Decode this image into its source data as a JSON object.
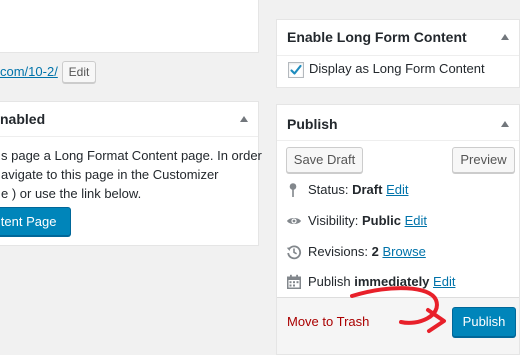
{
  "permalink": {
    "url_fragment": "com/10-2/",
    "edit_button": "Edit"
  },
  "long_format_box": {
    "title": "nabled",
    "desc_line1": "s page a Long Format Content page. In order",
    "desc_line2": "avigate to this page in the Customizer",
    "desc_line3": "e ) or use the link below.",
    "button_label": "ntent Page"
  },
  "enable_box": {
    "title": "Enable Long Form Content",
    "checkbox_label": "Display as Long Form Content",
    "checked": true
  },
  "publish_box": {
    "title": "Publish",
    "save_draft": "Save Draft",
    "preview": "Preview",
    "status_label": "Status:",
    "status_value": "Draft",
    "visibility_label": "Visibility:",
    "visibility_value": "Public",
    "revisions_label": "Revisions:",
    "revisions_value": "2",
    "revisions_link": "Browse",
    "publish_label": "Publish",
    "publish_value": "immediately",
    "edit_link": "Edit",
    "trash_link": "Move to Trash",
    "publish_button": "Publish"
  },
  "colors": {
    "accent": "#0073aa",
    "primary_button": "#0085ba",
    "trash_red": "#a00",
    "arrow_red": "#e8202a"
  },
  "icons": [
    "pin-icon",
    "eye-icon",
    "revisions-icon",
    "calendar-icon",
    "checkmark-icon",
    "collapse-caret-icon"
  ]
}
